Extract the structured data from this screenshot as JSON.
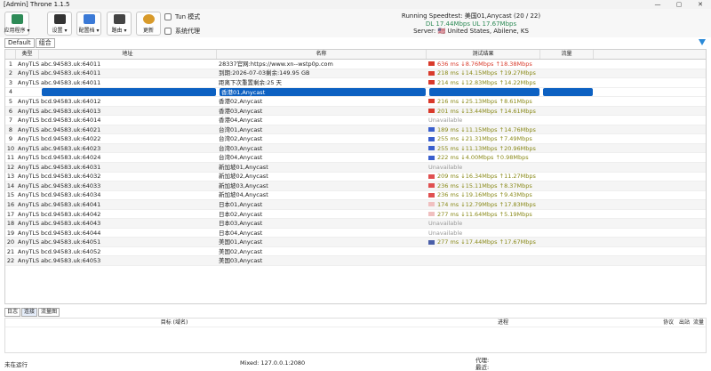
{
  "window": {
    "title": "[Admin] Throne 1.1.5",
    "controls": [
      "—",
      "▢",
      "✕"
    ]
  },
  "toolbar": {
    "buttons": [
      {
        "label": "应用程序 ▾",
        "color": "#2e8b57"
      },
      {
        "label": "设置 ▾",
        "color": "#333"
      },
      {
        "label": "配置档 ▾",
        "color": "#3a79d6"
      },
      {
        "label": "路由 ▾",
        "color": "#444"
      },
      {
        "label": "更新",
        "color": "#d89a2a"
      }
    ],
    "checkboxes": [
      {
        "label": "Tun 模式"
      },
      {
        "label": "系统代理"
      }
    ]
  },
  "status": {
    "line1": "Running Speedtest: 美国01,Anycast (20 / 22)",
    "line2": "DL 17.44Mbps UL 17.67Mbps",
    "line3": "Server: 🇺🇸 United States, Abilene, KS"
  },
  "groups": [
    "Default",
    "组合"
  ],
  "table": {
    "headers": [
      "类型",
      "地址",
      "名称",
      "测试结果",
      "流量"
    ],
    "rows": [
      {
        "n": "1",
        "type": "AnyTLS",
        "addr": "abc.94583.uk:64011",
        "name": "28337官网:https://www.xn--wstp0p.com",
        "res": "636 ms ↓8.76Mbps ↑18.38Mbps",
        "cls": "t-red",
        "flag": "#d93a2b"
      },
      {
        "n": "2",
        "type": "AnyTLS",
        "addr": "abc.94583.uk:64011",
        "name": "到期:2026-07-03剩余:149.95 GB",
        "res": "218 ms ↓14.15Mbps ↑19.27Mbps",
        "cls": "t-olive",
        "flag": "#d93a2b"
      },
      {
        "n": "3",
        "type": "AnyTLS",
        "addr": "abc.94583.uk:64011",
        "name": "距离下次重置剩余:25 天",
        "res": "214 ms ↓12.83Mbps ↑14.22Mbps",
        "cls": "t-olive",
        "flag": "#d93a2b"
      },
      {
        "n": "4",
        "type": "",
        "addr": "",
        "name": "香港01,Anycast",
        "res": "",
        "cls": "",
        "flag": "",
        "sel": true
      },
      {
        "n": "5",
        "type": "AnyTLS",
        "addr": "bcd.94583.uk:64012",
        "name": "香港02,Anycast",
        "res": "216 ms ↓25.13Mbps ↑8.61Mbps",
        "cls": "t-olive",
        "flag": "#d93a2b"
      },
      {
        "n": "6",
        "type": "AnyTLS",
        "addr": "abc.94583.uk:64013",
        "name": "香港03,Anycast",
        "res": "201 ms ↓13.44Mbps ↑14.61Mbps",
        "cls": "t-olive",
        "flag": "#d93a2b"
      },
      {
        "n": "7",
        "type": "AnyTLS",
        "addr": "bcd.94583.uk:64014",
        "name": "香港04,Anycast",
        "res": "Unavailable",
        "cls": "t-gray",
        "flag": ""
      },
      {
        "n": "8",
        "type": "AnyTLS",
        "addr": "abc.94583.uk:64021",
        "name": "台湾01,Anycast",
        "res": "189 ms ↓11.15Mbps ↑14.76Mbps",
        "cls": "t-olive",
        "flag": "#3a5fcd"
      },
      {
        "n": "9",
        "type": "AnyTLS",
        "addr": "bcd.94583.uk:64022",
        "name": "台湾02,Anycast",
        "res": "255 ms ↓21.31Mbps ↑7.49Mbps",
        "cls": "t-olive",
        "flag": "#3a5fcd"
      },
      {
        "n": "10",
        "type": "AnyTLS",
        "addr": "abc.94583.uk:64023",
        "name": "台湾03,Anycast",
        "res": "255 ms ↓11.13Mbps ↑20.96Mbps",
        "cls": "t-olive",
        "flag": "#3a5fcd"
      },
      {
        "n": "11",
        "type": "AnyTLS",
        "addr": "bcd.94583.uk:64024",
        "name": "台湾04,Anycast",
        "res": "222 ms ↓4.00Mbps ↑0.98Mbps",
        "cls": "t-olive",
        "flag": "#3a5fcd"
      },
      {
        "n": "12",
        "type": "AnyTLS",
        "addr": "abc.94583.uk:64031",
        "name": "新加坡01,Anycast",
        "res": "Unavailable",
        "cls": "t-gray",
        "flag": ""
      },
      {
        "n": "13",
        "type": "AnyTLS",
        "addr": "bcd.94583.uk:64032",
        "name": "新加坡02,Anycast",
        "res": "209 ms ↓16.34Mbps ↑11.27Mbps",
        "cls": "t-olive",
        "flag": "#e05050"
      },
      {
        "n": "14",
        "type": "AnyTLS",
        "addr": "abc.94583.uk:64033",
        "name": "新加坡03,Anycast",
        "res": "236 ms ↓15.11Mbps ↑8.37Mbps",
        "cls": "t-olive",
        "flag": "#e05050"
      },
      {
        "n": "15",
        "type": "AnyTLS",
        "addr": "bcd.94583.uk:64034",
        "name": "新加坡04,Anycast",
        "res": "236 ms ↓19.16Mbps ↑9.43Mbps",
        "cls": "t-olive",
        "flag": "#e05050"
      },
      {
        "n": "16",
        "type": "AnyTLS",
        "addr": "abc.94583.uk:64041",
        "name": "日本01,Anycast",
        "res": "174 ms ↓12.79Mbps ↑17.83Mbps",
        "cls": "t-olive",
        "flag": "#f0c0c0"
      },
      {
        "n": "17",
        "type": "AnyTLS",
        "addr": "bcd.94583.uk:64042",
        "name": "日本02,Anycast",
        "res": "277 ms ↓11.64Mbps ↑5.19Mbps",
        "cls": "t-olive",
        "flag": "#f0c0c0"
      },
      {
        "n": "18",
        "type": "AnyTLS",
        "addr": "abc.94583.uk:64043",
        "name": "日本03,Anycast",
        "res": "Unavailable",
        "cls": "t-gray",
        "flag": ""
      },
      {
        "n": "19",
        "type": "AnyTLS",
        "addr": "bcd.94583.uk:64044",
        "name": "日本04,Anycast",
        "res": "Unavailable",
        "cls": "t-gray",
        "flag": ""
      },
      {
        "n": "20",
        "type": "AnyTLS",
        "addr": "abc.94583.uk:64051",
        "name": "美国01,Anycast",
        "res": "277 ms ↓17.44Mbps ↑17.67Mbps",
        "cls": "t-olive",
        "flag": "#4a5fa8"
      },
      {
        "n": "21",
        "type": "AnyTLS",
        "addr": "bcd.94583.uk:64052",
        "name": "美国02,Anycast",
        "res": "",
        "cls": "",
        "flag": ""
      },
      {
        "n": "22",
        "type": "AnyTLS",
        "addr": "abc.94583.uk:64053",
        "name": "美国03,Anycast",
        "res": "",
        "cls": "",
        "flag": ""
      }
    ]
  },
  "bottomtabs": [
    "日志",
    "连接",
    "流量图"
  ],
  "conn": {
    "headers": [
      "目标 (域名)",
      "进程",
      "协议",
      "出站",
      "流量"
    ]
  },
  "footer": {
    "left": "未在运行",
    "mid": "Mixed: 127.0.0.1:2080",
    "right1": "代理:",
    "right2": "最近:"
  }
}
